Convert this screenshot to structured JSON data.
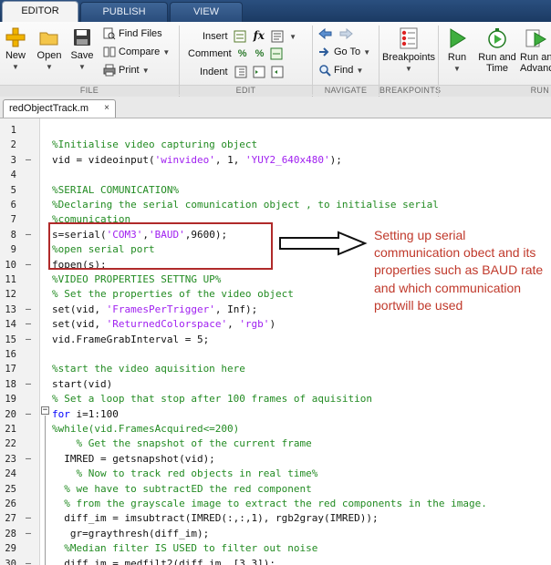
{
  "tabs": [
    {
      "label": "EDITOR",
      "active": true
    },
    {
      "label": "PUBLISH",
      "active": false
    },
    {
      "label": "VIEW",
      "active": false
    }
  ],
  "ribbon": {
    "file": {
      "group": "FILE",
      "new": "New",
      "open": "Open",
      "save": "Save",
      "find_files": "Find Files",
      "compare": "Compare",
      "print": "Print"
    },
    "edit": {
      "group": "EDIT",
      "insert": "Insert",
      "comment": "Comment",
      "indent": "Indent"
    },
    "navigate": {
      "group": "NAVIGATE",
      "go_to": "Go To",
      "find": "Find"
    },
    "breakpoints": {
      "group": "BREAKPOINTS",
      "breakpoints": "Breakpoints"
    },
    "run": {
      "group": "RUN",
      "run": "Run",
      "run_and_time_1": "Run and",
      "run_and_time_2": "Time",
      "run_and_advance_1": "Run and",
      "run_and_advance_2": "Advance"
    }
  },
  "file_tab": {
    "name": "redObjectTrack.m",
    "close": "×"
  },
  "code_lines": [
    {
      "n": "1",
      "m": "",
      "segs": []
    },
    {
      "n": "2",
      "m": "",
      "segs": [
        {
          "t": "%Initialise video capturing object",
          "c": "cm"
        }
      ]
    },
    {
      "n": "3",
      "m": "–",
      "segs": [
        {
          "t": "vid = videoinput(",
          "c": ""
        },
        {
          "t": "'winvideo'",
          "c": "st"
        },
        {
          "t": ", 1, ",
          "c": ""
        },
        {
          "t": "'YUY2_640x480'",
          "c": "st"
        },
        {
          "t": ");",
          "c": ""
        }
      ]
    },
    {
      "n": "4",
      "m": "",
      "segs": []
    },
    {
      "n": "5",
      "m": "",
      "segs": [
        {
          "t": "%SERIAL COMUNICATION%",
          "c": "cm"
        }
      ]
    },
    {
      "n": "6",
      "m": "",
      "segs": [
        {
          "t": "%Declaring the serial comunication object , to initialise serial",
          "c": "cm"
        }
      ]
    },
    {
      "n": "7",
      "m": "",
      "segs": [
        {
          "t": "%comunication",
          "c": "cm"
        }
      ]
    },
    {
      "n": "8",
      "m": "–",
      "segs": [
        {
          "t": "s=serial(",
          "c": ""
        },
        {
          "t": "'COM3'",
          "c": "st"
        },
        {
          "t": ",",
          "c": ""
        },
        {
          "t": "'BAUD'",
          "c": "st"
        },
        {
          "t": ",9600);",
          "c": ""
        }
      ]
    },
    {
      "n": "9",
      "m": "",
      "segs": [
        {
          "t": "%open serial port",
          "c": "cm"
        }
      ]
    },
    {
      "n": "10",
      "m": "–",
      "segs": [
        {
          "t": "fopen(s);",
          "c": ""
        }
      ]
    },
    {
      "n": "11",
      "m": "",
      "segs": [
        {
          "t": "%VIDEO PROPERTIES SETTNG UP%",
          "c": "cm"
        }
      ]
    },
    {
      "n": "12",
      "m": "",
      "segs": [
        {
          "t": "% Set the properties of the video object",
          "c": "cm"
        }
      ]
    },
    {
      "n": "13",
      "m": "–",
      "segs": [
        {
          "t": "set(vid, ",
          "c": ""
        },
        {
          "t": "'FramesPerTrigger'",
          "c": "st"
        },
        {
          "t": ", Inf);",
          "c": ""
        }
      ]
    },
    {
      "n": "14",
      "m": "–",
      "segs": [
        {
          "t": "set(vid, ",
          "c": ""
        },
        {
          "t": "'ReturnedColorspace'",
          "c": "st"
        },
        {
          "t": ", ",
          "c": ""
        },
        {
          "t": "'rgb'",
          "c": "st"
        },
        {
          "t": ")",
          "c": ""
        }
      ]
    },
    {
      "n": "15",
      "m": "–",
      "segs": [
        {
          "t": "vid.FrameGrabInterval = 5;",
          "c": ""
        }
      ]
    },
    {
      "n": "16",
      "m": "",
      "segs": []
    },
    {
      "n": "17",
      "m": "",
      "segs": [
        {
          "t": "%start the video aquisition here",
          "c": "cm"
        }
      ]
    },
    {
      "n": "18",
      "m": "–",
      "segs": [
        {
          "t": "start(vid)",
          "c": ""
        }
      ]
    },
    {
      "n": "19",
      "m": "",
      "segs": [
        {
          "t": "% Set a loop that stop after 100 frames of aquisition",
          "c": "cm"
        }
      ]
    },
    {
      "n": "20",
      "m": "–",
      "segs": [
        {
          "t": "for",
          "c": "kw"
        },
        {
          "t": " i=1:100",
          "c": ""
        }
      ]
    },
    {
      "n": "21",
      "m": "",
      "segs": [
        {
          "t": "%while(vid.FramesAcquired<=200)",
          "c": "cm"
        }
      ]
    },
    {
      "n": "22",
      "m": "",
      "segs": [
        {
          "t": "    % Get the snapshot of the current frame",
          "c": "cm"
        }
      ]
    },
    {
      "n": "23",
      "m": "–",
      "segs": [
        {
          "t": "  IMRED = getsnapshot(vid);",
          "c": ""
        }
      ]
    },
    {
      "n": "24",
      "m": "",
      "segs": [
        {
          "t": "    % Now to track red objects in real time%",
          "c": "cm"
        }
      ]
    },
    {
      "n": "25",
      "m": "",
      "segs": [
        {
          "t": "  % we have to subtractED the red component",
          "c": "cm"
        }
      ]
    },
    {
      "n": "26",
      "m": "",
      "segs": [
        {
          "t": "  % from the grayscale image to extract the red components in the image.",
          "c": "cm"
        }
      ]
    },
    {
      "n": "27",
      "m": "–",
      "segs": [
        {
          "t": "  diff_im = imsubtract(IMRED(:,:,1), rgb2gray(IMRED));",
          "c": ""
        }
      ]
    },
    {
      "n": "28",
      "m": "–",
      "segs": [
        {
          "t": "   gr=graythresh(diff_im);",
          "c": ""
        }
      ]
    },
    {
      "n": "29",
      "m": "",
      "segs": [
        {
          "t": "  %Median filter IS USED to filter out noise",
          "c": "cm"
        }
      ]
    },
    {
      "n": "30",
      "m": "–",
      "segs": [
        {
          "t": "  diff_im = medfilt2(diff_im, [3 3]);",
          "c": ""
        }
      ]
    }
  ],
  "annotation": {
    "text": "Setting up serial communication obect and its properties such as BAUD rate and which communication portwill be used"
  },
  "colors": {
    "annotation": "#c0392b",
    "box": "#b02a2a",
    "comment": "#228b22",
    "string": "#a020f0",
    "keyword": "#0000ff"
  }
}
